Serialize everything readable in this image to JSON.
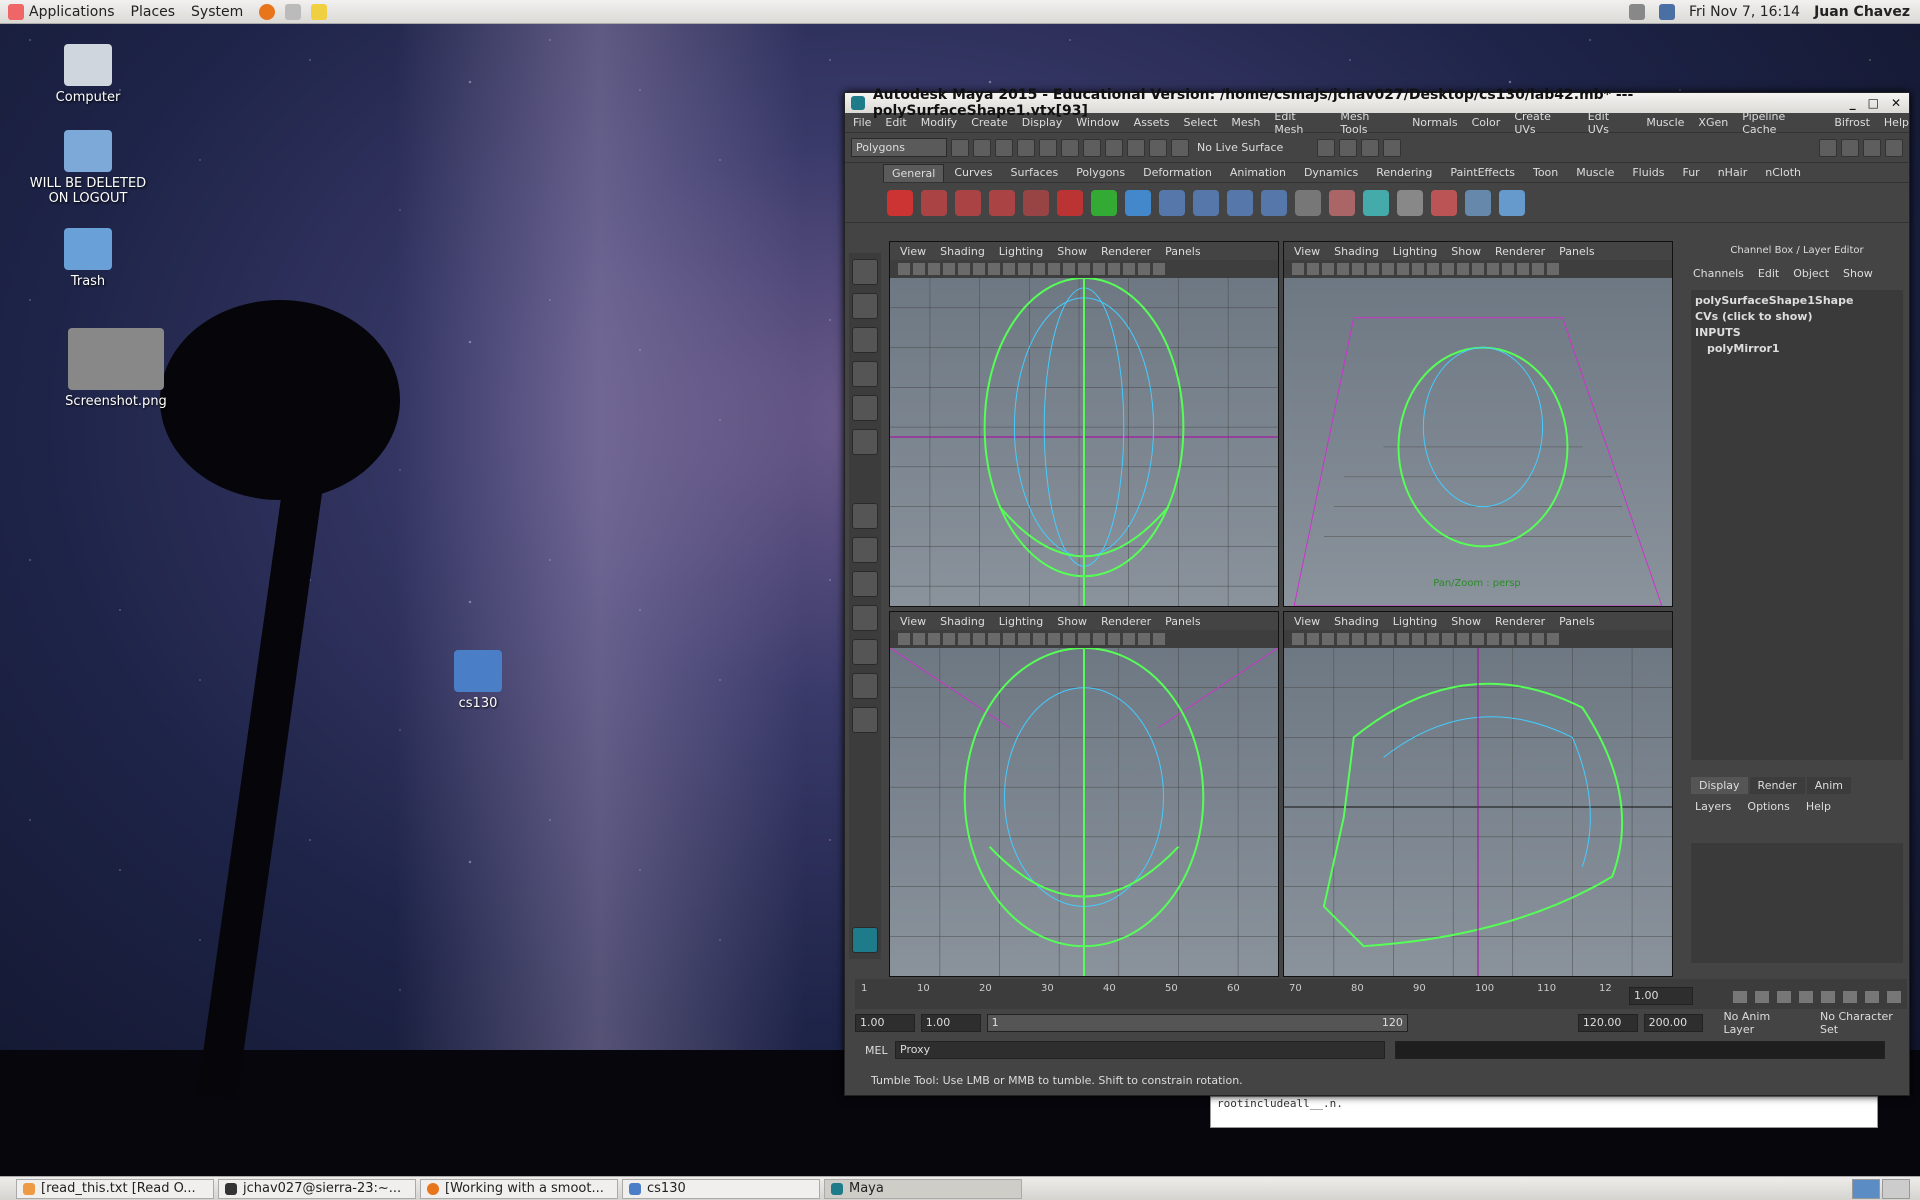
{
  "topbar": {
    "menus": [
      "Applications",
      "Places",
      "System"
    ],
    "clock": "Fri Nov  7, 16:14",
    "user": "Juan Chavez"
  },
  "desktop": {
    "icons": [
      "Computer",
      "WILL BE DELETED ON LOGOUT",
      "Trash",
      "Screenshot.png",
      "cs130"
    ]
  },
  "maya": {
    "title": "Autodesk Maya 2015 - Educational Version: /home/csmajs/jchav027/Desktop/cs130/lab42.mb*   ---   polySurfaceShape1.vtx[93]",
    "menus": [
      "File",
      "Edit",
      "Modify",
      "Create",
      "Display",
      "Window",
      "Assets",
      "Select",
      "Mesh",
      "Edit Mesh",
      "Mesh Tools",
      "Normals",
      "Color",
      "Create UVs",
      "Edit UVs",
      "Muscle",
      "XGen",
      "Pipeline Cache",
      "Bifrost",
      "Help"
    ],
    "mode": "Polygons",
    "live_surface": "No Live Surface",
    "shelf_tabs": [
      "General",
      "Curves",
      "Surfaces",
      "Polygons",
      "Deformation",
      "Animation",
      "Dynamics",
      "Rendering",
      "PaintEffects",
      "Toon",
      "Muscle",
      "Fluids",
      "Fur",
      "nHair",
      "nCloth"
    ],
    "viewport_menus": [
      "View",
      "Shading",
      "Lighting",
      "Show",
      "Renderer",
      "Panels"
    ],
    "persp_label": "Pan/Zoom : persp",
    "channel_box": {
      "header": "Channel Box / Layer Editor",
      "menus": [
        "Channels",
        "Edit",
        "Object",
        "Show"
      ],
      "items": [
        "polySurfaceShape1Shape",
        "CVs (click to show)",
        "INPUTS",
        "polyMirror1"
      ]
    },
    "layers": {
      "tabs": [
        "Display",
        "Render",
        "Anim"
      ],
      "menus": [
        "Layers",
        "Options",
        "Help"
      ]
    },
    "timeline_ticks": [
      "1",
      "10",
      "20",
      "30",
      "40",
      "50",
      "60",
      "70",
      "80",
      "90",
      "100",
      "110",
      "12"
    ],
    "current_frame": "1.00",
    "range": {
      "start": "1.00",
      "start2": "1.00",
      "slider_start": "1",
      "slider_end": "120",
      "end": "120.00",
      "end2": "200.00",
      "anim_layer": "No Anim Layer",
      "char_set": "No Character Set"
    },
    "cmd": {
      "lang": "MEL",
      "text": "Proxy"
    },
    "help_line": "Tumble Tool: Use LMB or MMB to tumble. Shift to constrain rotation."
  },
  "terminal_text": "rootincludeall__.n.",
  "taskbar": [
    "[read_this.txt [Read O...",
    "jchav027@sierra-23:~...",
    "[Working with a smoot...",
    "cs130",
    "Maya"
  ]
}
